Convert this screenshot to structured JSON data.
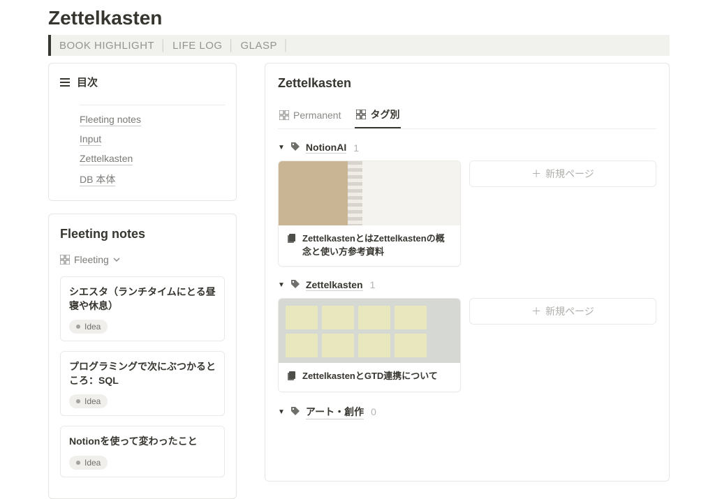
{
  "page": {
    "title": "Zettelkasten"
  },
  "navbar": {
    "items": [
      "BOOK HIGHLIGHT",
      "LIFE LOG",
      "GLASP"
    ]
  },
  "toc": {
    "title": "目次",
    "items": [
      "Fleeting notes",
      "Input",
      "Zettelkasten",
      "DB 本体"
    ]
  },
  "fleeting": {
    "title": "Fleeting notes",
    "view_label": "Fleeting",
    "tag_label": "Idea",
    "notes": [
      {
        "title": "シエスタ（ランチタイムにとる昼寝や休息）"
      },
      {
        "title": "プログラミングで次にぶつかるところ：SQL"
      },
      {
        "title": "Notionを使って変わったこと"
      }
    ]
  },
  "db": {
    "title": "Zettelkasten",
    "tabs": [
      {
        "label": "Permanent",
        "active": false
      },
      {
        "label": "タグ別",
        "active": true
      }
    ],
    "new_page_label": "新規ページ",
    "groups": [
      {
        "name": "NotionAI",
        "count": "1",
        "card": {
          "title": "ZettelkastenとはZettelkastenの概念と使い方参考資料",
          "thumb": "notebook"
        }
      },
      {
        "name": "Zettelkasten",
        "count": "1",
        "card": {
          "title": "ZettelkastenとGTD連携について",
          "thumb": "sticky"
        }
      },
      {
        "name": "アート・創作",
        "count": "0",
        "card": null
      }
    ]
  }
}
